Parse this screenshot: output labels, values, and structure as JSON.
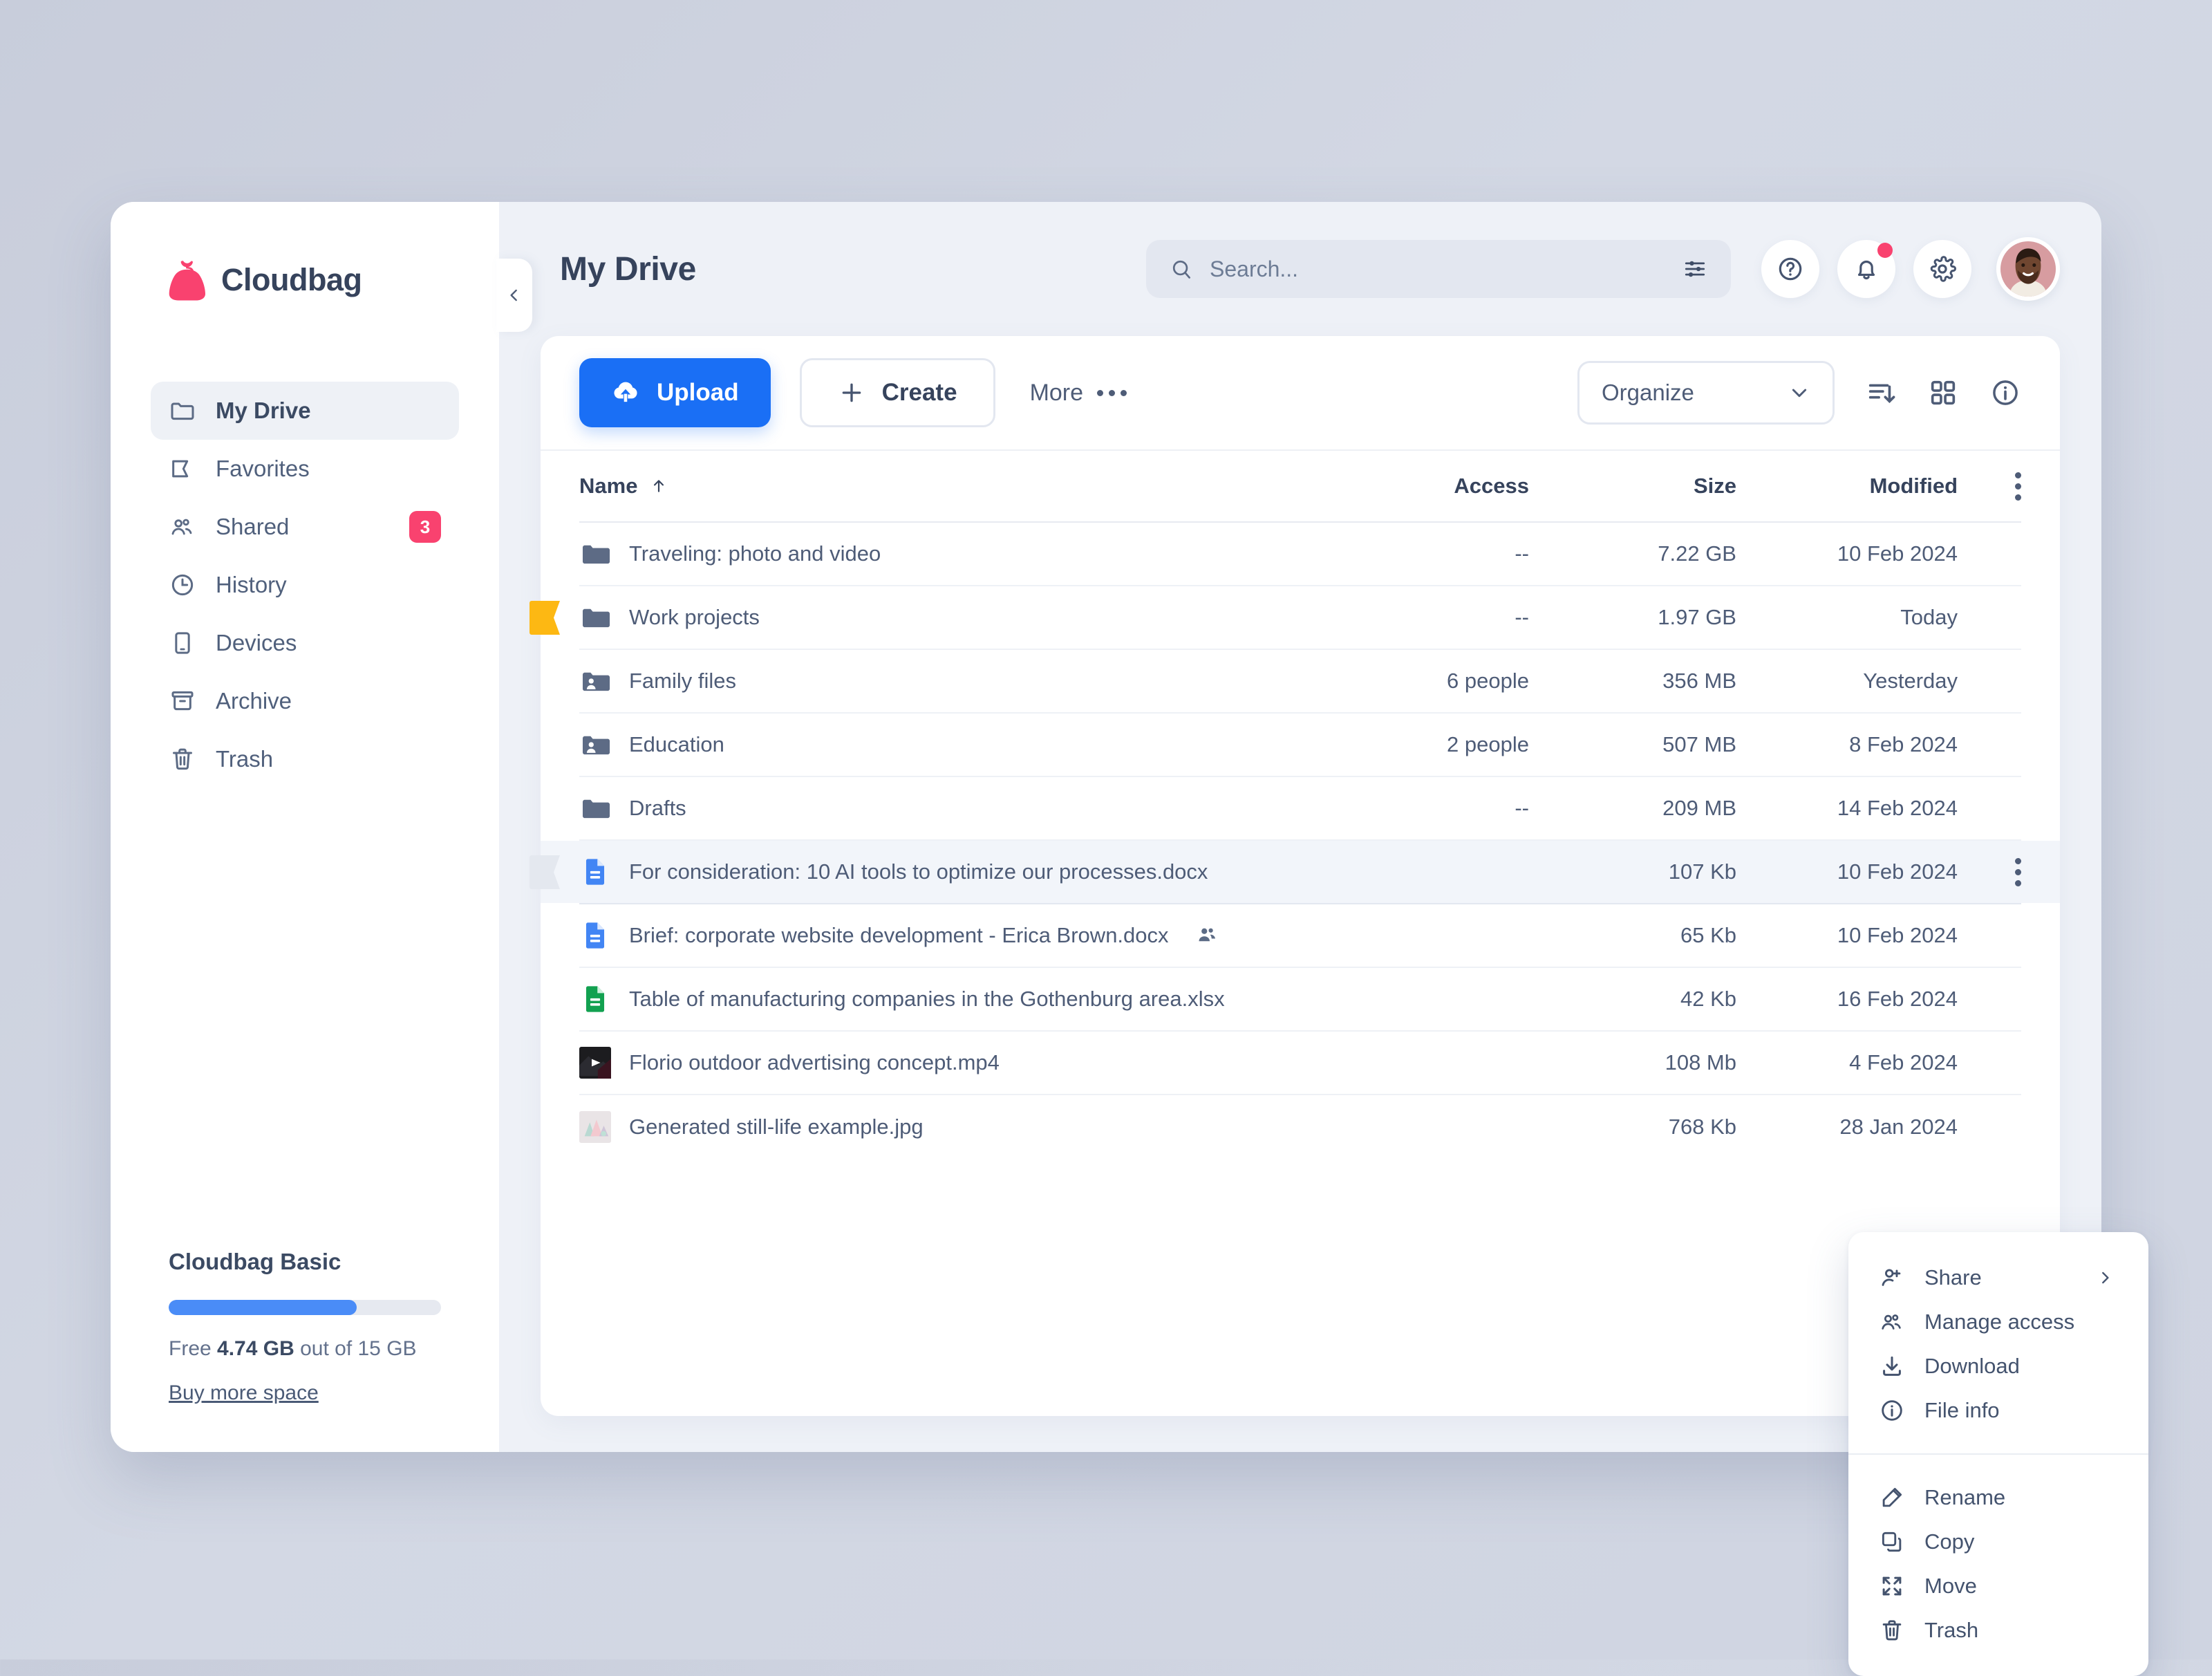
{
  "brand": {
    "name": "Cloudbag",
    "logo_color": "#f9426f"
  },
  "sidebar": {
    "items": [
      {
        "label": "My Drive",
        "icon": "folder-icon",
        "active": true,
        "badge": ""
      },
      {
        "label": "Favorites",
        "icon": "bookmark-icon",
        "active": false,
        "badge": ""
      },
      {
        "label": "Shared",
        "icon": "people-icon",
        "active": false,
        "badge": "3"
      },
      {
        "label": "History",
        "icon": "clock-icon",
        "active": false,
        "badge": ""
      },
      {
        "label": "Devices",
        "icon": "device-icon",
        "active": false,
        "badge": ""
      },
      {
        "label": "Archive",
        "icon": "archive-icon",
        "active": false,
        "badge": ""
      },
      {
        "label": "Trash",
        "icon": "trash-icon",
        "active": false,
        "badge": ""
      }
    ],
    "plan": {
      "title": "Cloudbag Basic",
      "used_percent": 69,
      "free_prefix": "Free ",
      "free_amount": "4.74 GB",
      "free_suffix": " out of 15 GB",
      "buy_link": "Buy more space",
      "bar_color": "#4a8cf7"
    },
    "collapse_icon": "chevron-left-icon"
  },
  "header": {
    "title": "My Drive",
    "search_placeholder": "Search...",
    "search_value": "",
    "icons": [
      "help-icon",
      "bell-icon",
      "gear-icon"
    ],
    "notification_dot": true,
    "avatar_alt": "user-avatar"
  },
  "toolbar": {
    "upload_label": "Upload",
    "create_label": "Create",
    "more_label": "More",
    "organize_label": "Organize",
    "upload_color": "#1a6ff5",
    "view_icons": [
      "sort-icon",
      "grid-view-icon",
      "info-icon"
    ]
  },
  "table": {
    "columns": {
      "name": "Name",
      "access": "Access",
      "size": "Size",
      "modified": "Modified"
    },
    "sort_direction": "asc",
    "rows": [
      {
        "name": "Traveling: photo and video",
        "icon": "folder",
        "access": "--",
        "size": "7.22 GB",
        "modified": "10 Feb 2024",
        "marker": "",
        "selected": false,
        "shared": false
      },
      {
        "name": "Work projects",
        "icon": "folder",
        "access": "--",
        "size": "1.97 GB",
        "modified": "Today",
        "marker": "#fdb813",
        "selected": false,
        "shared": false
      },
      {
        "name": "Family files",
        "icon": "folder-shared",
        "access": "6 people",
        "size": "356 MB",
        "modified": "Yesterday",
        "marker": "",
        "selected": false,
        "shared": false
      },
      {
        "name": "Education",
        "icon": "folder-shared",
        "access": "2 people",
        "size": "507 MB",
        "modified": "8 Feb 2024",
        "marker": "",
        "selected": false,
        "shared": false
      },
      {
        "name": "Drafts",
        "icon": "folder",
        "access": "--",
        "size": "209 MB",
        "modified": "14 Feb 2024",
        "marker": "",
        "selected": false,
        "shared": false
      },
      {
        "name": "For consideration: 10 AI tools to optimize our processes.docx",
        "icon": "doc",
        "access": "",
        "size": "107 Kb",
        "modified": "10 Feb 2024",
        "marker": "#e4e8ef",
        "selected": true,
        "shared": false
      },
      {
        "name": "Brief: corporate website development - Erica Brown.docx",
        "icon": "doc",
        "access": "",
        "size": "65 Kb",
        "modified": "10 Feb 2024",
        "marker": "",
        "selected": false,
        "shared": true
      },
      {
        "name": "Table of manufacturing companies in the Gothenburg area.xlsx",
        "icon": "sheet",
        "access": "",
        "size": "42 Kb",
        "modified": "16 Feb 2024",
        "marker": "",
        "selected": false,
        "shared": false
      },
      {
        "name": "Florio outdoor advertising concept.mp4",
        "icon": "video",
        "access": "",
        "size": "108 Mb",
        "modified": "4 Feb 2024",
        "marker": "",
        "selected": false,
        "shared": false
      },
      {
        "name": "Generated still-life example.jpg",
        "icon": "image",
        "access": "",
        "size": "768 Kb",
        "modified": "28 Jan 2024",
        "marker": "",
        "selected": false,
        "shared": false
      }
    ]
  },
  "context_menu": {
    "group_one": [
      {
        "label": "Share",
        "icon": "person-add-icon",
        "submenu": true
      },
      {
        "label": "Manage access",
        "icon": "people-icon",
        "submenu": false
      },
      {
        "label": "Download",
        "icon": "download-icon",
        "submenu": false
      },
      {
        "label": "File info",
        "icon": "info-icon",
        "submenu": false
      }
    ],
    "group_two": [
      {
        "label": "Rename",
        "icon": "pencil-icon",
        "submenu": false
      },
      {
        "label": "Copy",
        "icon": "copy-icon",
        "submenu": false
      },
      {
        "label": "Move",
        "icon": "move-icon",
        "submenu": false
      },
      {
        "label": "Trash",
        "icon": "trash-icon",
        "submenu": false
      }
    ]
  }
}
